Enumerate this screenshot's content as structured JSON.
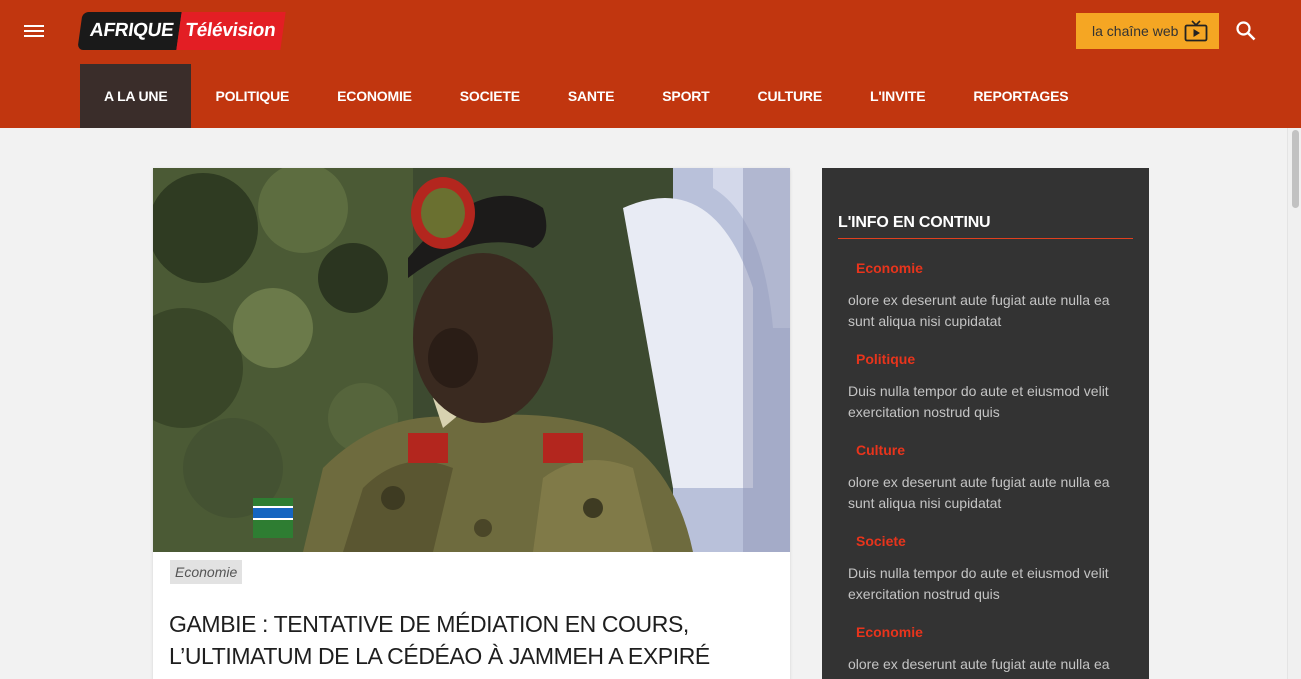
{
  "header": {
    "logo_part1": "AFRIQUE",
    "logo_part2": "Télévision",
    "web_channel_label": "la chaîne web"
  },
  "nav": {
    "items": [
      {
        "label": "A LA UNE",
        "active": true
      },
      {
        "label": "POLITIQUE"
      },
      {
        "label": "ECONOMIE"
      },
      {
        "label": "SOCIETE"
      },
      {
        "label": "SANTE"
      },
      {
        "label": "SPORT"
      },
      {
        "label": "CULTURE"
      },
      {
        "label": "L'INVITE"
      },
      {
        "label": "REPORTAGES"
      }
    ]
  },
  "article": {
    "category": "Economie",
    "title": "GAMBIE : TENTATIVE DE MÉDIATION EN COURS, L’ULTIMATUM DE LA CÉDÉAO À JAMMEH A EXPIRÉ"
  },
  "sidebar": {
    "heading": "L'INFO EN CONTINU",
    "items": [
      {
        "category": "Economie",
        "text": "olore ex deserunt aute fugiat aute nulla ea sunt aliqua nisi cupidatat"
      },
      {
        "category": "Politique",
        "text": "Duis nulla tempor do aute et eiusmod velit exercitation nostrud quis"
      },
      {
        "category": "Culture",
        "text": "olore ex deserunt aute fugiat aute nulla ea sunt aliqua nisi cupidatat"
      },
      {
        "category": "Societe",
        "text": "Duis nulla tempor do aute et eiusmod velit exercitation nostrud quis"
      },
      {
        "category": "Economie",
        "text": "olore ex deserunt aute fugiat aute nulla ea sunt aliqua nisi cupidatat"
      }
    ]
  },
  "icons": {
    "menu": "menu-icon",
    "web_tv": "tv-play-icon",
    "search": "search-icon"
  },
  "colors": {
    "header_bg": "#c1360f",
    "nav_active_bg": "#3a2d2a",
    "accent_orange": "#f5a623",
    "sidebar_bg": "#333333",
    "category_red": "#e8341c"
  }
}
